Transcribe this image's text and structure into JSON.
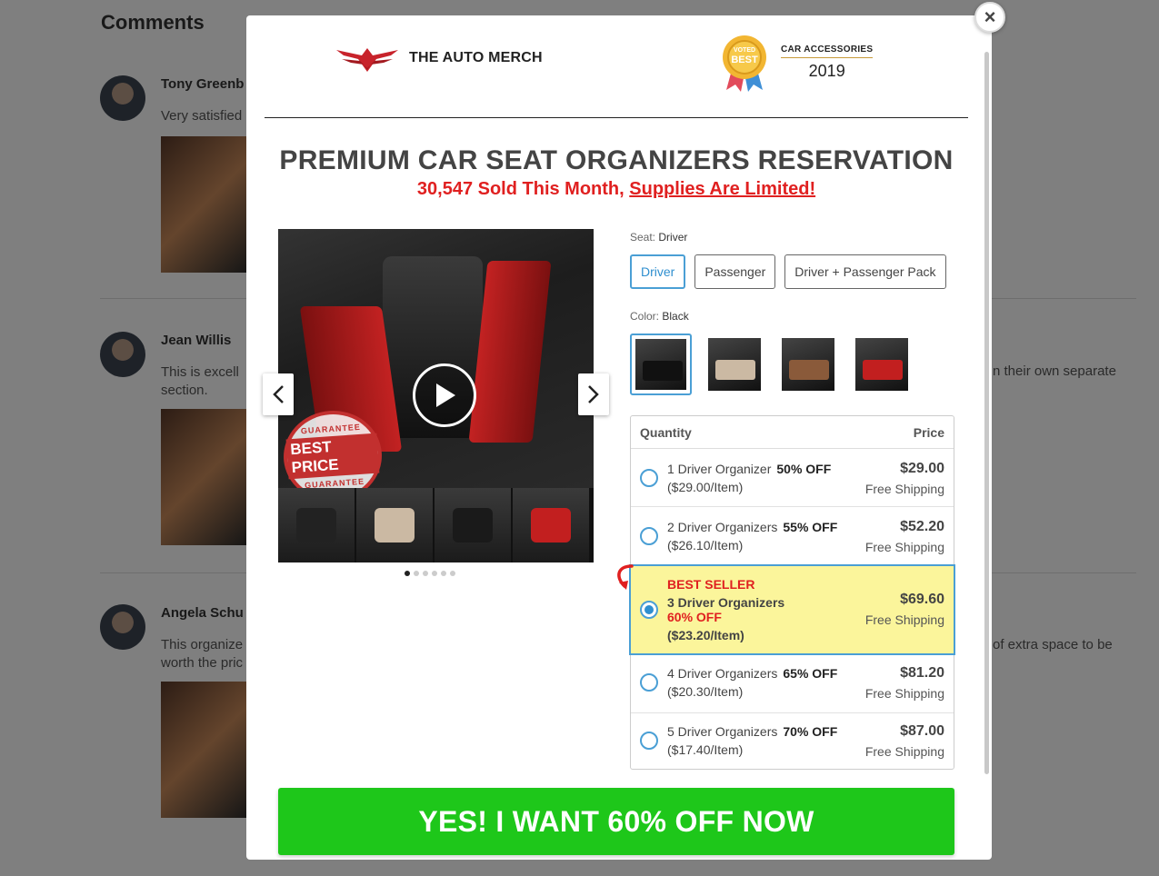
{
  "background": {
    "comments_title": "Comments",
    "comments": [
      {
        "name": "Tony Greenb",
        "text": "Very satisfied"
      },
      {
        "name": "Jean Willis",
        "text": "This is excell",
        "text2": "section.",
        "right_text": "n their own separate"
      },
      {
        "name": "Angela Schu",
        "text": "This organize",
        "text2": "worth the pric",
        "right_text": "of extra space to be"
      }
    ]
  },
  "modal": {
    "close_label": "×",
    "brand": "THE AUTO MERCH",
    "badge": {
      "top": "VOTED",
      "main": "BEST",
      "category": "CAR ACCESSORIES",
      "year": "2019"
    },
    "title": "PREMIUM CAR SEAT ORGANIZERS RESERVATION",
    "subtitle_prefix": "30,547 Sold This Month, ",
    "subtitle_link": "Supplies Are Limited!",
    "gallery": {
      "stamp_top": "GUARANTEE",
      "stamp_main": "BEST PRICE",
      "stamp_bottom": "GUARANTEE",
      "dots_count": 6,
      "active_dot": 0
    },
    "seat": {
      "label": "Seat:",
      "selected": "Driver",
      "options": [
        "Driver",
        "Passenger",
        "Driver + Passenger Pack"
      ]
    },
    "color": {
      "label": "Color:",
      "selected": "Black",
      "swatches": [
        "#111111",
        "#cbb9a3",
        "#8a5a3a",
        "#c21f1f"
      ]
    },
    "pricing": {
      "col_quantity": "Quantity",
      "col_price": "Price",
      "rows": [
        {
          "qty": "1 Driver Organizer",
          "off": "50% OFF",
          "per": "($29.00/Item)",
          "price": "$29.00",
          "shipping": "Free Shipping"
        },
        {
          "qty": "2 Driver Organizers",
          "off": "55% OFF",
          "per": "($26.10/Item)",
          "price": "$52.20",
          "shipping": "Free Shipping"
        },
        {
          "badge": "BEST SELLER",
          "qty": "3 Driver Organizers",
          "off": "60% OFF",
          "per": "($23.20/Item)",
          "price": "$69.60",
          "shipping": "Free Shipping"
        },
        {
          "qty": "4 Driver Organizers",
          "off": "65% OFF",
          "per": "($20.30/Item)",
          "price": "$81.20",
          "shipping": "Free Shipping"
        },
        {
          "qty": "5 Driver Organizers",
          "off": "70% OFF",
          "per": "($17.40/Item)",
          "price": "$87.00",
          "shipping": "Free Shipping"
        }
      ],
      "selected_index": 2
    },
    "cta": "YES! I WANT 60% OFF NOW",
    "colors": {
      "accent": "#4a9fd5",
      "cta": "#1ec71a",
      "alert": "#e02020",
      "highlight": "#fbf59b"
    }
  }
}
